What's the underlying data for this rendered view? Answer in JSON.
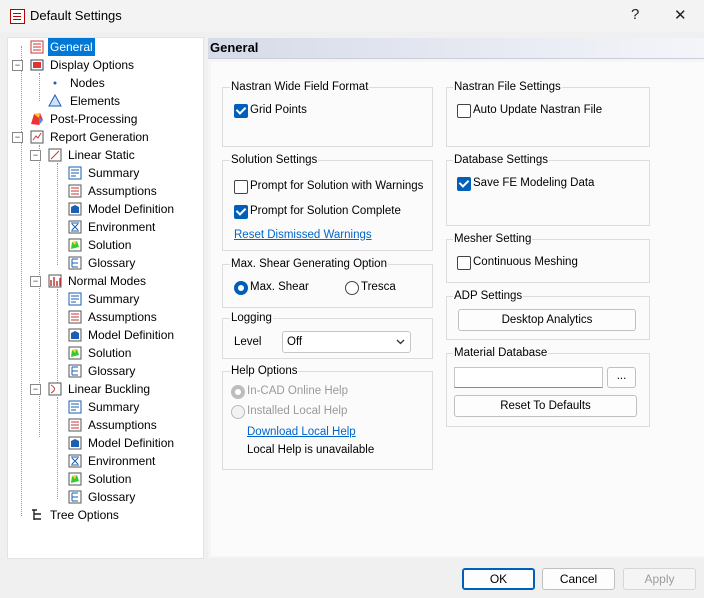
{
  "window": {
    "title": "Default Settings",
    "help_glyph": "?",
    "close_glyph": "✕"
  },
  "tree": {
    "general": "General",
    "display_options": "Display Options",
    "nodes": "Nodes",
    "elements": "Elements",
    "post_processing": "Post-Processing",
    "report_generation": "Report Generation",
    "linear_static": "Linear Static",
    "normal_modes": "Normal Modes",
    "linear_buckling": "Linear Buckling",
    "summary": "Summary",
    "assumptions": "Assumptions",
    "model_definition": "Model Definition",
    "environment": "Environment",
    "solution": "Solution",
    "glossary": "Glossary",
    "tree_options": "Tree Options"
  },
  "panel": {
    "title": "General",
    "nastran_wide": {
      "title": "Nastran Wide Field Format",
      "grid_points": "Grid Points"
    },
    "nastran_file": {
      "title": "Nastran File Settings",
      "auto_update": "Auto Update Nastran File"
    },
    "solution": {
      "title": "Solution Settings",
      "prompt_warnings": "Prompt for Solution with Warnings",
      "prompt_complete": "Prompt for Solution Complete",
      "reset_link": "Reset Dismissed Warnings"
    },
    "database": {
      "title": "Database Settings",
      "save_fe": "Save FE Modeling Data"
    },
    "mesher": {
      "title": "Mesher Setting",
      "continuous": "Continuous Meshing"
    },
    "shear": {
      "title": "Max. Shear Generating Option",
      "max_shear": "Max. Shear",
      "tresca": "Tresca"
    },
    "adp": {
      "title": "ADP Settings",
      "desktop_analytics": "Desktop Analytics"
    },
    "logging": {
      "title": "Logging",
      "level_label": "Level",
      "level_value": "Off"
    },
    "material": {
      "title": "Material Database",
      "path_value": "",
      "browse": "...",
      "reset": "Reset To Defaults"
    },
    "help": {
      "title": "Help Options",
      "in_cad": "In-CAD Online Help",
      "installed": "Installed Local Help",
      "download_link": "Download Local Help",
      "status": "Local Help is unavailable"
    }
  },
  "footer": {
    "ok": "OK",
    "cancel": "Cancel",
    "apply": "Apply"
  },
  "colors": {
    "accent": "#0078d7",
    "check": "#005fb8",
    "link": "#0066cc"
  }
}
